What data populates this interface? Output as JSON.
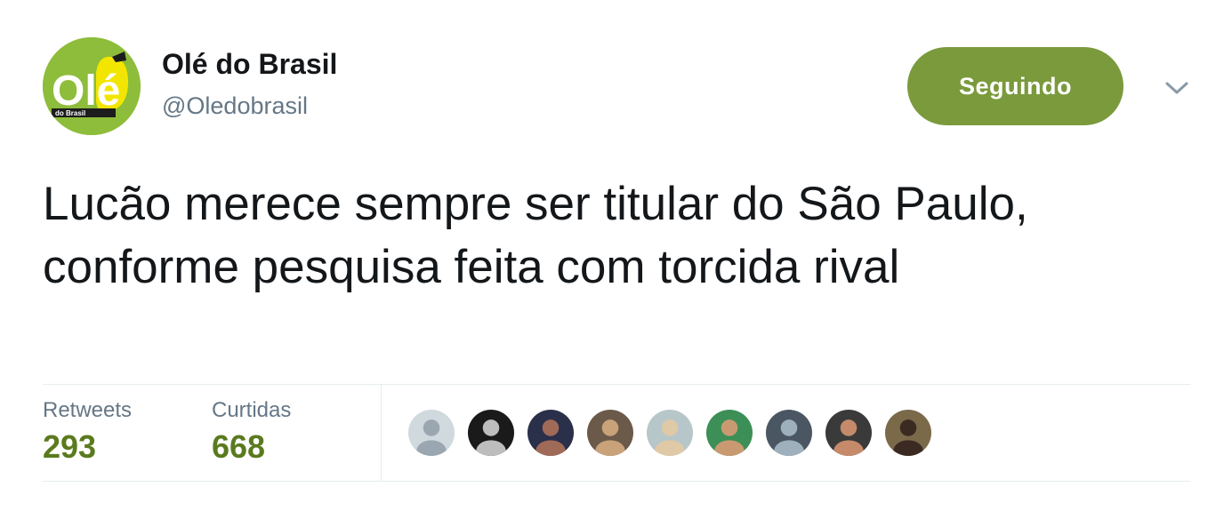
{
  "account": {
    "display_name": "Olé do Brasil",
    "handle": "@Oledobrasil",
    "logo_text": "Olé",
    "logo_subtext": "do Brasil"
  },
  "follow_button": {
    "label": "Seguindo"
  },
  "menu_icon": "chevron-down-icon",
  "tweet": {
    "text": "Lucão merece sempre ser titular do São Paulo, conforme pesquisa feita com torcida rival"
  },
  "stats": {
    "retweets_label": "Retweets",
    "retweets_count": "293",
    "likes_label": "Curtidas",
    "likes_count": "668"
  },
  "likers": [
    {
      "type": "default",
      "colors": [
        "#cfd9de",
        "#9aa7b0"
      ]
    },
    {
      "type": "photo",
      "colors": [
        "#1a1a1a",
        "#bdbdbd"
      ]
    },
    {
      "type": "photo",
      "colors": [
        "#2a2f4a",
        "#a06a58"
      ]
    },
    {
      "type": "photo",
      "colors": [
        "#6b5a4a",
        "#c9a27a"
      ]
    },
    {
      "type": "photo",
      "colors": [
        "#b7c6c9",
        "#e0c9a6"
      ]
    },
    {
      "type": "photo",
      "colors": [
        "#3c8f56",
        "#c99a72"
      ]
    },
    {
      "type": "photo",
      "colors": [
        "#4a5763",
        "#9fb0bd"
      ]
    },
    {
      "type": "photo",
      "colors": [
        "#3a3a3a",
        "#c48a6a"
      ]
    },
    {
      "type": "photo",
      "colors": [
        "#7a6a4a",
        "#3a2a22"
      ]
    }
  ],
  "colors": {
    "brand_green": "#7a9a3c",
    "count_green": "#5a7a1e",
    "logo_green": "#8dbd3a",
    "logo_yellow": "#f2e600"
  }
}
